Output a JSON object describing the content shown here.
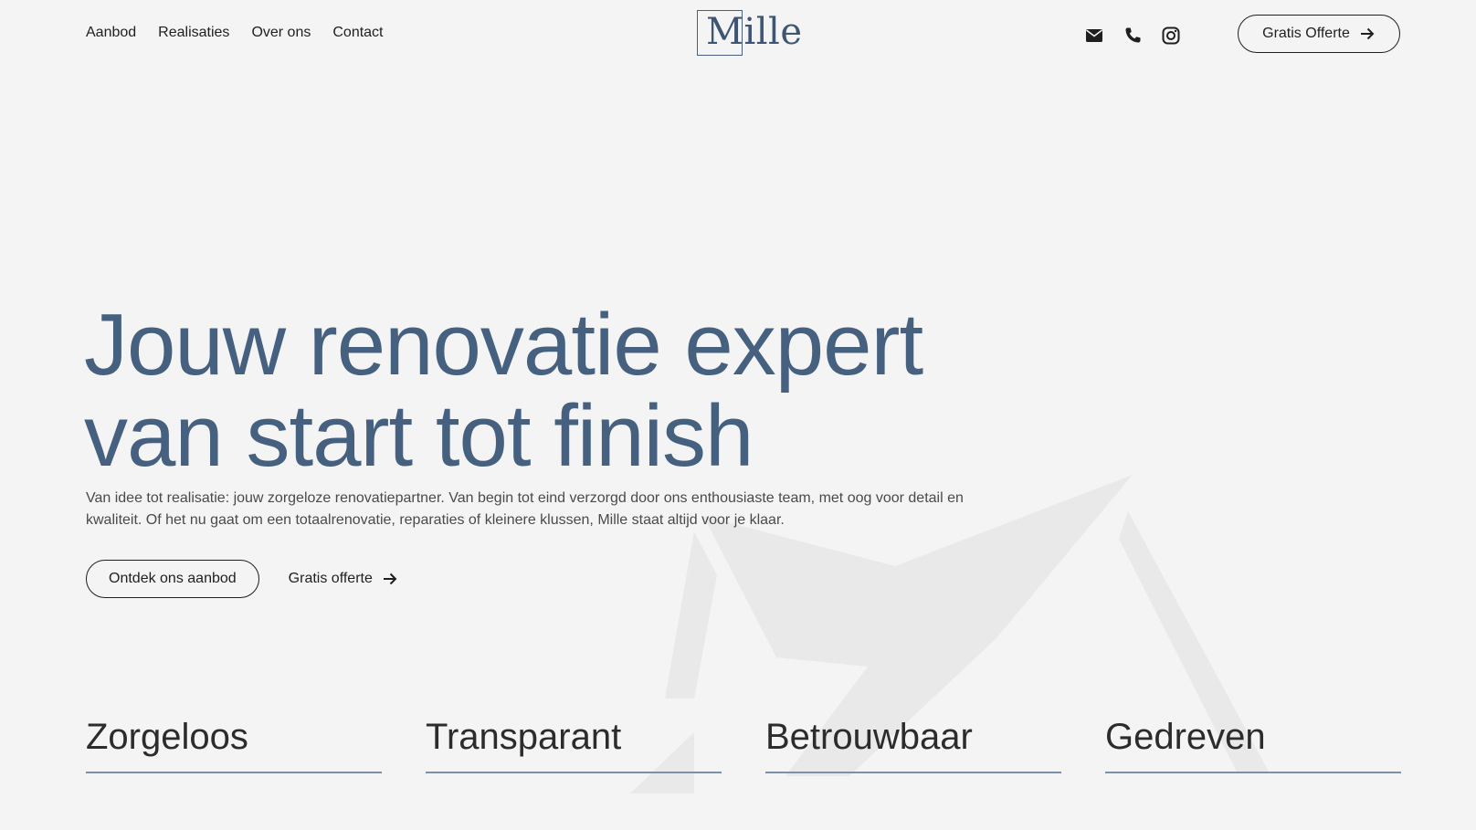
{
  "nav": {
    "items": [
      {
        "label": "Aanbod"
      },
      {
        "label": "Realisaties"
      },
      {
        "label": "Over ons"
      },
      {
        "label": "Contact"
      }
    ]
  },
  "logo": {
    "text": "Mille"
  },
  "social": {
    "icons": [
      "mail-icon",
      "phone-icon",
      "instagram-icon"
    ]
  },
  "header": {
    "cta_label": "Gratis Offerte"
  },
  "hero": {
    "title_line1": "Jouw renovatie expert",
    "title_line2": "van start tot finish",
    "description": "Van idee tot realisatie: jouw zorgeloze renovatiepartner. Van begin tot eind verzorgd door ons enthousiaste team, met oog voor detail en kwaliteit. Of het nu gaat om een totaalrenovatie, reparaties of kleinere klussen, Mille staat altijd voor je klaar.",
    "primary_button": "Ontdek ons aanbod",
    "secondary_link": "Gratis offerte"
  },
  "values": [
    {
      "title": "Zorgeloos"
    },
    {
      "title": "Transparant"
    },
    {
      "title": "Betrouwbaar"
    },
    {
      "title": "Gedreven"
    }
  ],
  "colors": {
    "background": "#f4f4f4",
    "accent": "#46607f",
    "text": "#1f1f1f",
    "divider": "#7e8fa8"
  }
}
